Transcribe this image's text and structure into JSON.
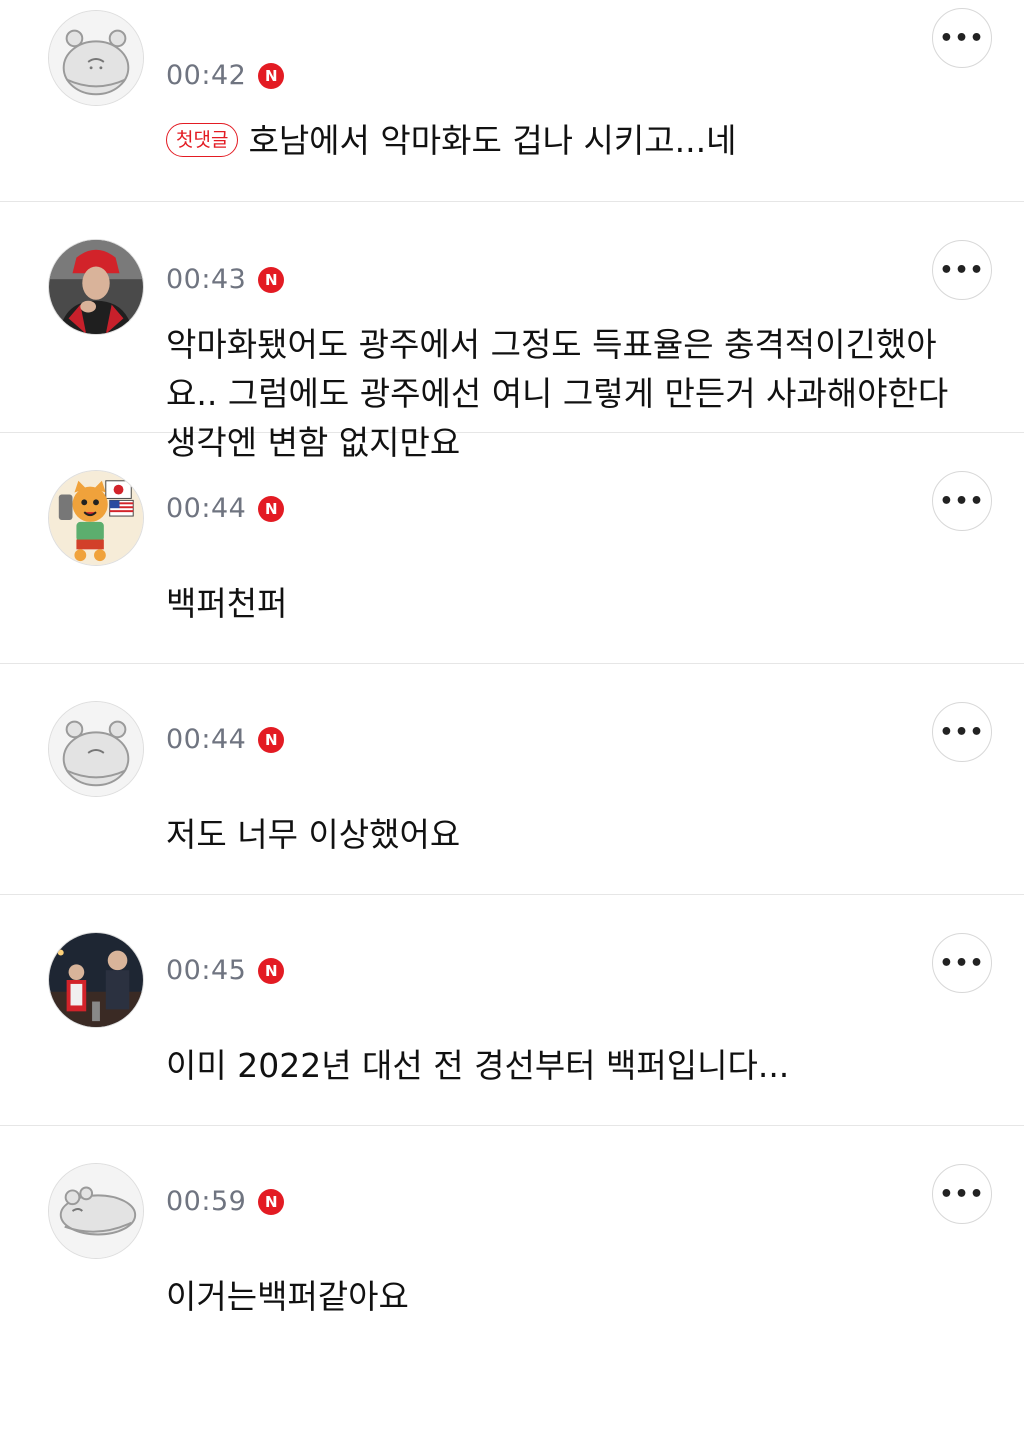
{
  "more_label": "•••",
  "n_badge": "N",
  "comments": [
    {
      "time": "00:42",
      "badge": "첫댓글",
      "text": "호남에서 악마화도 겁나 시키고...네"
    },
    {
      "time": "00:43",
      "text": "악마화됐어도 광주에서 그정도 득표율은 충격적이긴했아요.. 그럼에도 광주에선 여니 그렇게 만든거 사과해야한다 생각엔 변함 없지만요"
    },
    {
      "time": "00:44",
      "text": "백퍼천퍼"
    },
    {
      "time": "00:44",
      "text": "저도 너무 이상했어요"
    },
    {
      "time": "00:45",
      "text": "이미 2022년 대선 전 경선부터 백퍼입니다..."
    },
    {
      "time": "00:59",
      "text": "이거는백퍼같아요"
    }
  ],
  "colors": {
    "accent": "#e31b23",
    "time": "#6f7480",
    "divider": "#e6e6e6"
  }
}
